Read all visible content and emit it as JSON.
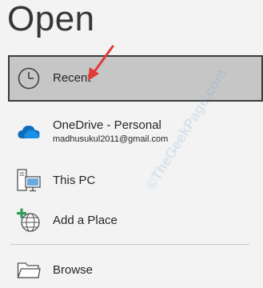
{
  "page": {
    "title": "Open"
  },
  "locations": {
    "recent": {
      "label": "Recent",
      "icon": "clock-icon"
    },
    "onedrive": {
      "label": "OneDrive - Personal",
      "account": "madhusukul2011@gmail.com",
      "icon": "cloud-icon"
    },
    "this_pc": {
      "label": "This PC",
      "icon": "computer-icon"
    },
    "add_place": {
      "label": "Add a Place",
      "icon": "globe-plus-icon"
    },
    "browse": {
      "label": "Browse",
      "icon": "folder-icon"
    }
  },
  "annotation": {
    "icon": "red-arrow-pointer"
  },
  "watermark": {
    "text": "©TheGeekPage.com"
  },
  "colors": {
    "selected_background": "#c6c6c6",
    "selected_border": "#3c3c3c",
    "onedrive_blue": "#0f6cbd",
    "arrow_red": "#e03a3a"
  }
}
